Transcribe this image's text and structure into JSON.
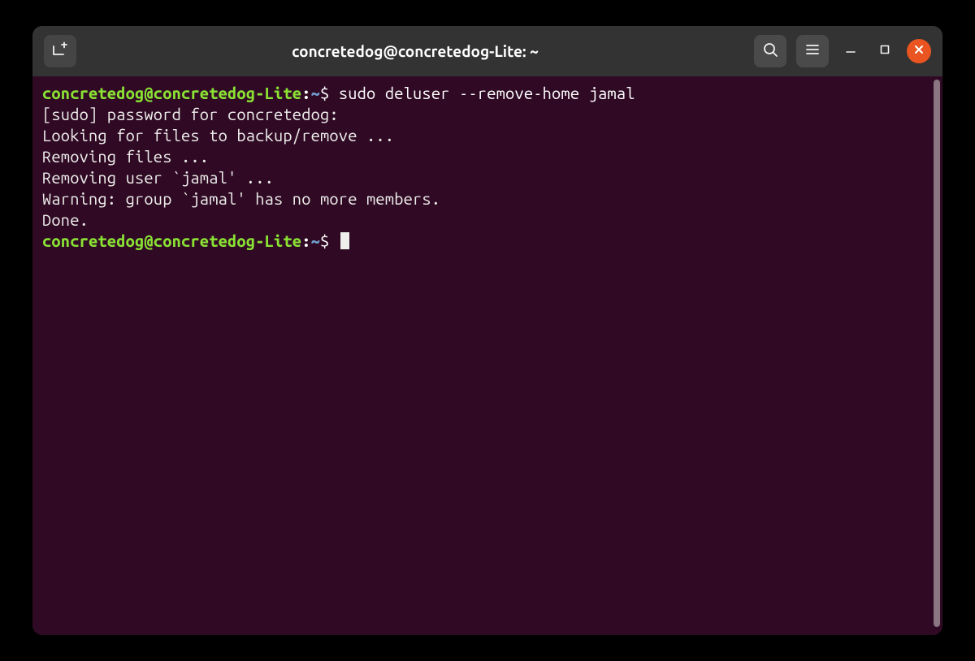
{
  "titlebar": {
    "title": "concretedog@concretedog-Lite: ~"
  },
  "terminal": {
    "prompt1": {
      "user_host": "concretedog@concretedog-Lite",
      "sep": ":",
      "path": "~",
      "dollar": "$ ",
      "command": "sudo deluser --remove-home jamal"
    },
    "output": [
      "[sudo] password for concretedog: ",
      "Looking for files to backup/remove ...",
      "Removing files ...",
      "Removing user `jamal' ...",
      "Warning: group `jamal' has no more members.",
      "Done."
    ],
    "prompt2": {
      "user_host": "concretedog@concretedog-Lite",
      "sep": ":",
      "path": "~",
      "dollar": "$ "
    }
  },
  "colors": {
    "accent_close": "#e95420",
    "terminal_bg": "#300a24",
    "prompt_green": "#8ae234",
    "prompt_blue": "#729fcf",
    "titlebar_bg": "#333333"
  }
}
